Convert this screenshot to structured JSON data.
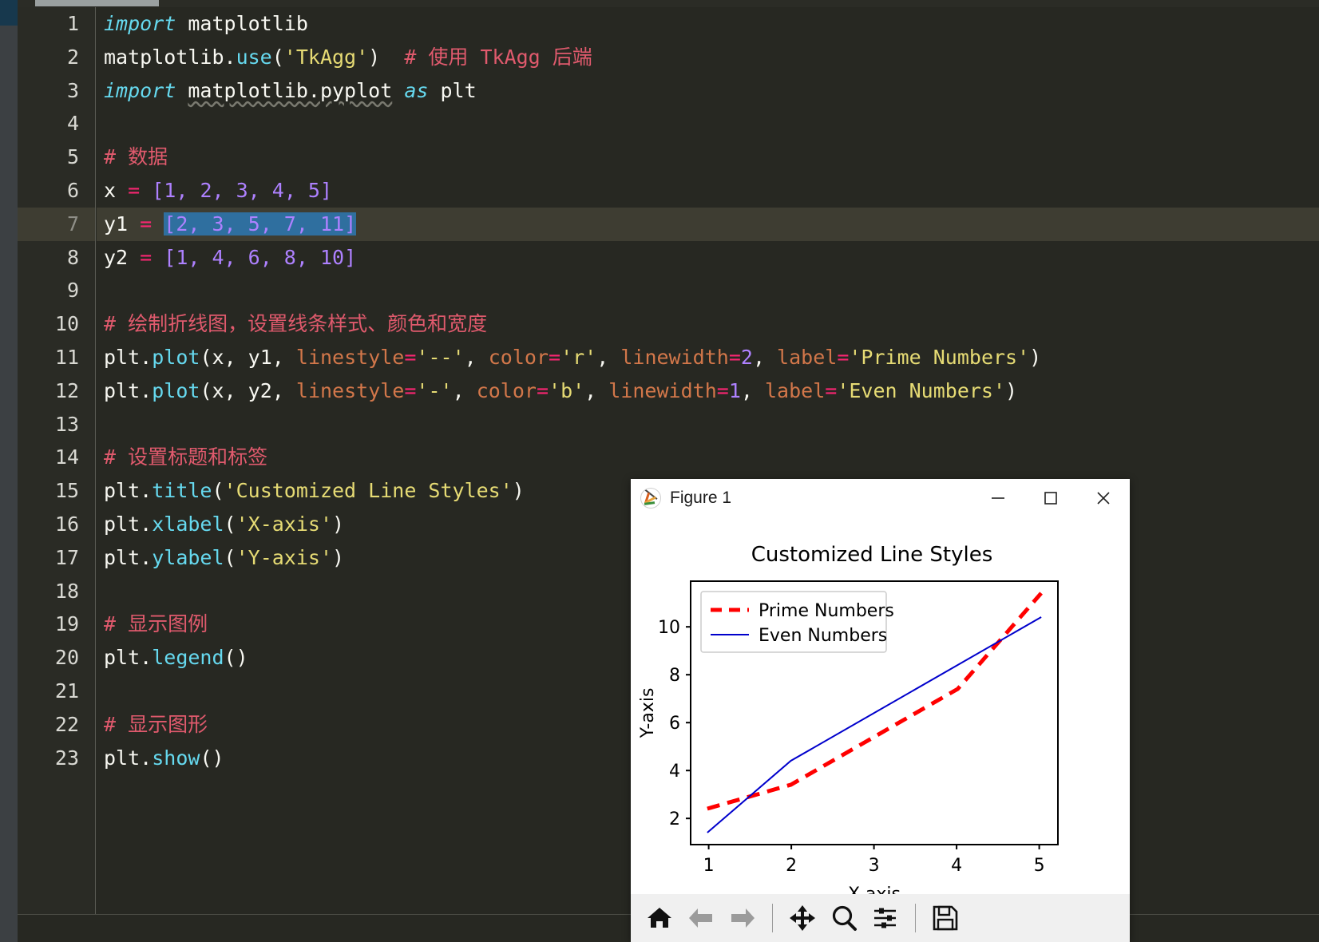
{
  "editor": {
    "gutter_numbers": [
      "1",
      "2",
      "3",
      "4",
      "5",
      "6",
      "7",
      "8",
      "9",
      "10",
      "11",
      "12",
      "13",
      "14",
      "15",
      "16",
      "17",
      "18",
      "19",
      "20",
      "21",
      "22",
      "23"
    ],
    "active_line": 7,
    "lines": [
      {
        "n": 1,
        "text": "import matplotlib"
      },
      {
        "n": 2,
        "text": "matplotlib.use('TkAgg')  # 使用 TkAgg 后端"
      },
      {
        "n": 3,
        "text": "import matplotlib.pyplot as plt"
      },
      {
        "n": 4,
        "text": ""
      },
      {
        "n": 5,
        "text": "# 数据"
      },
      {
        "n": 6,
        "text": "x = [1, 2, 3, 4, 5]"
      },
      {
        "n": 7,
        "text": "y1 = [2, 3, 5, 7, 11]"
      },
      {
        "n": 8,
        "text": "y2 = [1, 4, 6, 8, 10]"
      },
      {
        "n": 9,
        "text": ""
      },
      {
        "n": 10,
        "text": "# 绘制折线图，设置线条样式、颜色和宽度"
      },
      {
        "n": 11,
        "text": "plt.plot(x, y1, linestyle='--', color='r', linewidth=2, label='Prime Numbers')"
      },
      {
        "n": 12,
        "text": "plt.plot(x, y2, linestyle='-', color='b', linewidth=1, label='Even Numbers')"
      },
      {
        "n": 13,
        "text": ""
      },
      {
        "n": 14,
        "text": "# 设置标题和标签"
      },
      {
        "n": 15,
        "text": "plt.title('Customized Line Styles')"
      },
      {
        "n": 16,
        "text": "plt.xlabel('X-axis')"
      },
      {
        "n": 17,
        "text": "plt.ylabel('Y-axis')"
      },
      {
        "n": 18,
        "text": ""
      },
      {
        "n": 19,
        "text": "# 显示图例"
      },
      {
        "n": 20,
        "text": "plt.legend()"
      },
      {
        "n": 21,
        "text": ""
      },
      {
        "n": 22,
        "text": "# 显示图形"
      },
      {
        "n": 23,
        "text": "plt.show()"
      }
    ],
    "tokens": {
      "import": "import",
      "as": "as",
      "matplotlib": "matplotlib",
      "matplotlib_dot": "matplotlib.",
      "use": "use",
      "tkagg_str": "'TkAgg'",
      "comment_tkagg": "# 使用 TkAgg 后端",
      "pyplot": "matplotlib.pyplot",
      "plt": "plt",
      "comment_data": "# 数据",
      "comment_plot": "# 绘制折线图，设置线条样式、颜色和宽度",
      "comment_title": "# 设置标题和标签",
      "comment_legend": "# 显示图例",
      "comment_show": "# 显示图形",
      "x_name": "x",
      "y1_name": "y1",
      "y2_name": "y2",
      "eq": "=",
      "x_list": "[1, 2, 3, 4, 5]",
      "y1_list": "[2, 3, 5, 7, 11]",
      "y2_list": "[1, 4, 6, 8, 10]",
      "plot": "plot",
      "title": "title",
      "xlabel": "xlabel",
      "ylabel": "ylabel",
      "legend": "legend",
      "show": "show",
      "linestyle": "linestyle",
      "color": "color",
      "linewidth": "linewidth",
      "label": "label",
      "dashes_str": "'--'",
      "solid_str": "'-'",
      "r_str": "'r'",
      "b_str": "'b'",
      "lw2": "2",
      "lw1": "1",
      "prime_str": "'Prime Numbers'",
      "even_str": "'Even Numbers'",
      "title_str": "'Customized Line Styles'",
      "xlabel_str": "'X-axis'",
      "ylabel_str": "'Y-axis'"
    },
    "colors": {
      "background": "#272822",
      "active_line": "#3e3d32",
      "gutter": "#2a2b25",
      "keyword": "#66d9ef",
      "string": "#e6db74",
      "number": "#ae81ff",
      "operator": "#f92672",
      "comment": "#e05a6d",
      "param": "#d2774a",
      "text": "#f8f8f2",
      "selection": "#2f6f9f",
      "activity_bar": "#3c4043",
      "activity_marker": "#17384d"
    }
  },
  "figure_window": {
    "title": "Figure 1",
    "icon_name": "matplotlib-logo-icon",
    "window_buttons": [
      {
        "name": "minimize-button",
        "glyph": "minimize"
      },
      {
        "name": "maximize-button",
        "glyph": "maximize"
      },
      {
        "name": "close-button",
        "glyph": "close"
      }
    ],
    "toolbar": [
      {
        "name": "home-button",
        "tooltip": "Home"
      },
      {
        "name": "back-button",
        "tooltip": "Back"
      },
      {
        "name": "forward-button",
        "tooltip": "Forward"
      },
      {
        "name": "pan-button",
        "tooltip": "Pan"
      },
      {
        "name": "zoom-button",
        "tooltip": "Zoom"
      },
      {
        "name": "configure-subplots-button",
        "tooltip": "Configure subplots"
      },
      {
        "name": "save-button",
        "tooltip": "Save"
      }
    ]
  },
  "chart_data": {
    "type": "line",
    "title": "Customized Line Styles",
    "xlabel": "X-axis",
    "ylabel": "Y-axis",
    "x": [
      1,
      2,
      3,
      4,
      5
    ],
    "series": [
      {
        "name": "Prime Numbers",
        "values": [
          2,
          3,
          5,
          7,
          11
        ],
        "color": "#ff0000",
        "linestyle": "--",
        "linewidth": 2
      },
      {
        "name": "Even Numbers",
        "values": [
          1,
          4,
          6,
          8,
          10
        ],
        "color": "#0000cc",
        "linestyle": "-",
        "linewidth": 1
      }
    ],
    "xticks": [
      1,
      2,
      3,
      4,
      5
    ],
    "yticks": [
      2,
      4,
      6,
      8,
      10
    ],
    "xlim": [
      0.8,
      5.2
    ],
    "ylim": [
      0.5,
      11.5
    ],
    "grid": false,
    "legend_position": "upper left"
  }
}
